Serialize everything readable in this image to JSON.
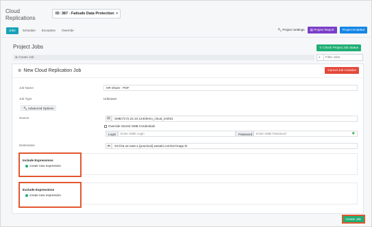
{
  "app": {
    "title_line1": "Cloud",
    "title_line2": "Replications"
  },
  "project_select": {
    "value": "ID: 387 - Failsafe Data Protection"
  },
  "tabs": [
    {
      "label": "Jobs",
      "active": true
    },
    {
      "label": "Schedule",
      "active": false
    },
    {
      "label": "Exception",
      "active": false
    },
    {
      "label": "Override",
      "active": false
    }
  ],
  "header_buttons": {
    "settings": "Project Settings",
    "report": "Project Report",
    "enabled": "Project Enabled"
  },
  "jobs": {
    "title": "Project Jobs",
    "check_status": "Check Project Job Status",
    "create_job": "Create Job",
    "filter_placeholder": "Filter Jobs"
  },
  "form": {
    "title": "New Cloud Replication Job",
    "cancel": "Cancel Job Creation",
    "job_name_label": "Job Name",
    "job_name_value": "HR Share - PDF",
    "job_type_label": "Job Type",
    "job_type_value": "Unknown",
    "advanced_options": "Advanced Options",
    "source_label": "Source",
    "source_value": "SMB://172.22.10.124/demo_cloud_smb01",
    "override_label": "Override Stored SMB Credentials",
    "login_label": "Login",
    "login_placeholder": "Enter SMB Login",
    "password_label": "Password",
    "password_placeholder": "Enter SMB Password",
    "destination_label": "Destination",
    "destination_value": "S3://s3.us-east-1.{practical}.wasabi.com/s3-hrapp-hr",
    "include_title": "Include Expressions",
    "include_create": "create new expression",
    "exclude_title": "Exclude Expressions",
    "exclude_create": "create new expression",
    "create_button": "Create Job"
  },
  "colors": {
    "teal": "#17a2b8",
    "green": "#1fae74",
    "red": "#e4483b",
    "purple": "#7a3fc8",
    "blue": "#1486e6",
    "highlight": "#e2552e"
  }
}
